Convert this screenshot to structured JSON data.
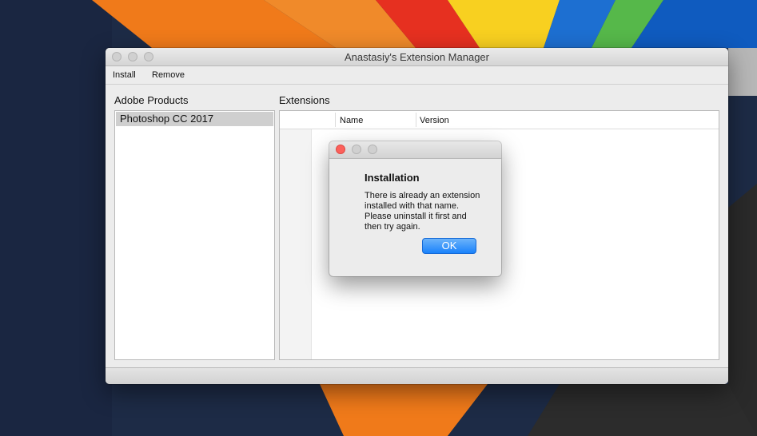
{
  "window": {
    "title": "Anastasiy's Extension Manager"
  },
  "menu": {
    "install": "Install",
    "remove": "Remove"
  },
  "products": {
    "label": "Adobe Products",
    "items": [
      "Photoshop CC 2017"
    ]
  },
  "extensions": {
    "label": "Extensions",
    "columns": [
      "Name",
      "Version"
    ]
  },
  "dialog": {
    "title": "Installation",
    "message": "There is already an extension installed with that name. Please uninstall it first and then try again.",
    "ok_label": "OK"
  },
  "colors": {
    "accent": "#1a82fb",
    "close_button": "#fc605b"
  }
}
